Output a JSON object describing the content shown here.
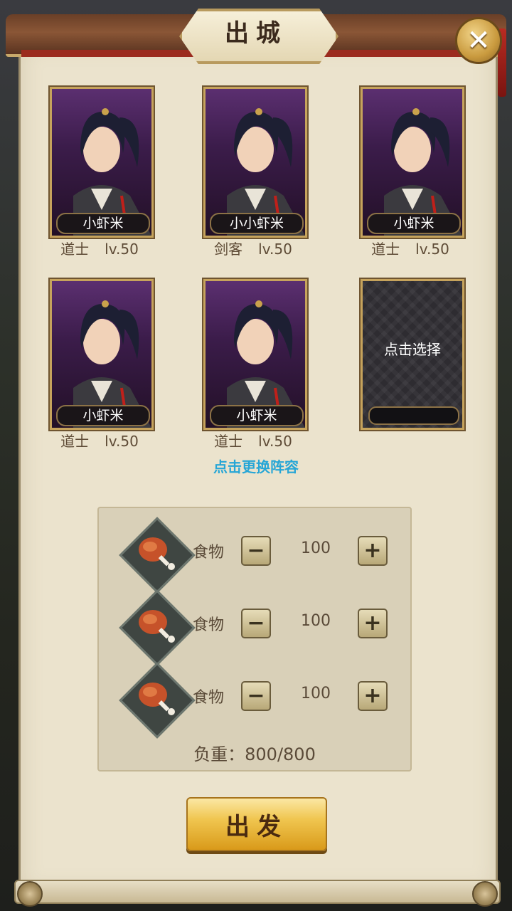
{
  "title": "出城",
  "close_icon": "close-icon",
  "heroes": [
    {
      "name": "小虾米",
      "class": "道士",
      "level": "lv.50"
    },
    {
      "name": "小小虾米",
      "class": "剑客",
      "level": "lv.50"
    },
    {
      "name": "小虾米",
      "class": "道士",
      "level": "lv.50"
    },
    {
      "name": "小虾米",
      "class": "道士",
      "level": "lv.50"
    },
    {
      "name": "小虾米",
      "class": "道士",
      "level": "lv.50"
    }
  ],
  "empty_slot": {
    "label": "点击选择"
  },
  "change_lineup": "点击更换阵容",
  "supplies": [
    {
      "label": "食物",
      "quantity": "100",
      "minus": "−",
      "plus": "+"
    },
    {
      "label": "食物",
      "quantity": "100",
      "minus": "−",
      "plus": "+"
    },
    {
      "label": "食物",
      "quantity": "100",
      "minus": "−",
      "plus": "+"
    }
  ],
  "weight": "负重：800/800",
  "depart_button": "出发",
  "colors": {
    "accent_gold": "#d99a1a",
    "link_blue": "#27a6d6",
    "panel": "#ebe3cd"
  }
}
